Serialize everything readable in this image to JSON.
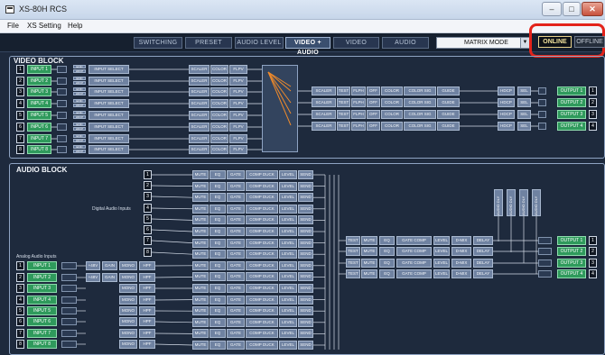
{
  "window": {
    "title": "XS-80H RCS",
    "minimize": "–",
    "maximize": "□",
    "close": "✕"
  },
  "menu": [
    {
      "label": "File"
    },
    {
      "label": "XS Setting"
    },
    {
      "label": "Help"
    }
  ],
  "tabs": [
    {
      "label": "SWITCHING",
      "active": false
    },
    {
      "label": "PRESET",
      "active": false
    },
    {
      "label": "AUDIO LEVEL",
      "active": false
    },
    {
      "label": "VIDEO + AUDIO",
      "active": true
    },
    {
      "label": "VIDEO",
      "active": false
    },
    {
      "label": "AUDIO",
      "active": false
    }
  ],
  "mode": {
    "value": "MATRIX MODE"
  },
  "connection": {
    "online": "ONLINE",
    "offline": "OFFLINE"
  },
  "video_block": {
    "title": "VIDEO BLOCK",
    "inputs": [
      {
        "num": "1",
        "label": "INPUT 1"
      },
      {
        "num": "2",
        "label": "INPUT 2"
      },
      {
        "num": "3",
        "label": "INPUT 3"
      },
      {
        "num": "4",
        "label": "INPUT 4"
      },
      {
        "num": "5",
        "label": "INPUT 5"
      },
      {
        "num": "6",
        "label": "INPUT 6"
      },
      {
        "num": "7",
        "label": "INPUT 7"
      },
      {
        "num": "8",
        "label": "INPUT 8"
      }
    ],
    "edid_label": "EDID",
    "hdcp_label": "HDCP",
    "input_select": "INPUT SELECT",
    "scaler_chain": [
      "SCALER",
      "COLOR",
      "FLPV"
    ],
    "output_chain": [
      "SCALER",
      "TEST",
      "FLPH",
      "OFF",
      "COLOR",
      "COLOR SIG",
      "GUIDE"
    ],
    "hdcp": "HDCP",
    "sel": "SEL",
    "outputs": [
      {
        "num": "1",
        "label": "OUTPUT 1"
      },
      {
        "num": "2",
        "label": "OUTPUT 2"
      },
      {
        "num": "3",
        "label": "OUTPUT 3"
      },
      {
        "num": "4",
        "label": "OUTPUT 4"
      }
    ]
  },
  "audio_block": {
    "title": "AUDIO BLOCK",
    "digital_label": "Digital Audio Inputs",
    "digital_nums": [
      "1",
      "2",
      "3",
      "4",
      "5",
      "6",
      "7",
      "8"
    ],
    "analog_label": "Analog Audio Inputs",
    "analog_inputs": [
      {
        "num": "1",
        "label": "INPUT 1"
      },
      {
        "num": "2",
        "label": "INPUT 2"
      },
      {
        "num": "3",
        "label": "INPUT 3"
      },
      {
        "num": "4",
        "label": "INPUT 4"
      },
      {
        "num": "5",
        "label": "INPUT 5"
      },
      {
        "num": "6",
        "label": "INPUT 6"
      },
      {
        "num": "7",
        "label": "INPUT 7"
      },
      {
        "num": "8",
        "label": "INPUT 8"
      }
    ],
    "phantom": "+48V",
    "gain": "GAIN",
    "mono": "MONO",
    "hpf": "HPF",
    "channel_chain": [
      "MUTE",
      "EQ",
      "GATE",
      "COMP DUCK",
      "LEVEL",
      "SEND"
    ],
    "mixer_label": "AUDIO DLY",
    "output_chain": [
      "TEST",
      "MUTE",
      "EQ",
      "GATE COMP",
      "LEVEL",
      "D-MIX",
      "DELAY"
    ],
    "outputs": [
      {
        "num": "1",
        "label": "OUTPUT 1"
      },
      {
        "num": "2",
        "label": "OUTPUT 2"
      },
      {
        "num": "3",
        "label": "OUTPUT 3"
      },
      {
        "num": "4",
        "label": "OUTPUT 4"
      }
    ]
  }
}
